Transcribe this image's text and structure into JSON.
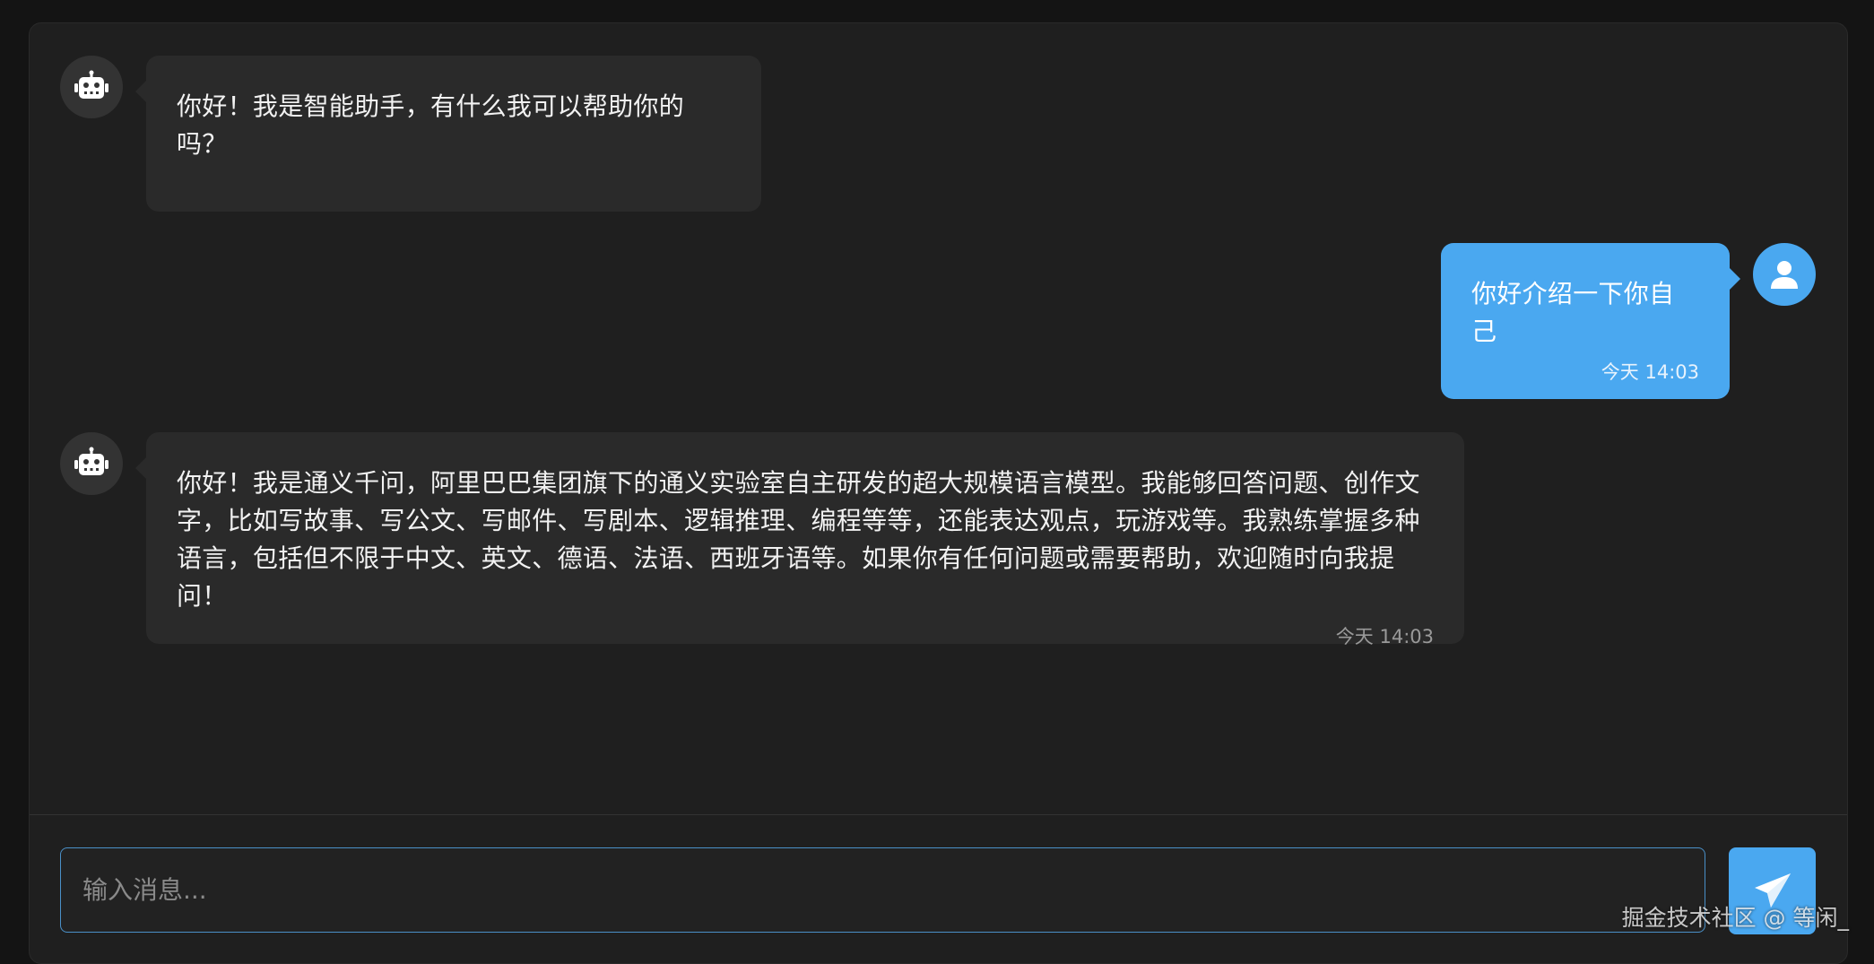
{
  "messages": [
    {
      "role": "bot",
      "text": "你好！我是智能助手，有什么我可以帮助你的吗？",
      "time": ""
    },
    {
      "role": "user",
      "text": "你好介绍一下你自己",
      "time": "今天 14:03"
    },
    {
      "role": "bot",
      "text": "你好！我是通义千问，阿里巴巴集团旗下的通义实验室自主研发的超大规模语言模型。我能够回答问题、创作文字，比如写故事、写公文、写邮件、写剧本、逻辑推理、编程等等，还能表达观点，玩游戏等。我熟练掌握多种语言，包括但不限于中文、英文、德语、法语、西班牙语等。如果你有任何问题或需要帮助，欢迎随时向我提问！",
      "time": "今天 14:03"
    }
  ],
  "composer": {
    "placeholder": "输入消息...",
    "value": ""
  },
  "icons": {
    "bot_avatar": "robot-icon",
    "user_avatar": "user-icon",
    "send": "paper-plane-icon"
  },
  "colors": {
    "accent": "#4aa8f0",
    "background": "#1f1f1f",
    "bot_bubble": "#2a2a2a"
  },
  "watermark": "掘金技术社区 @ 等闲_"
}
